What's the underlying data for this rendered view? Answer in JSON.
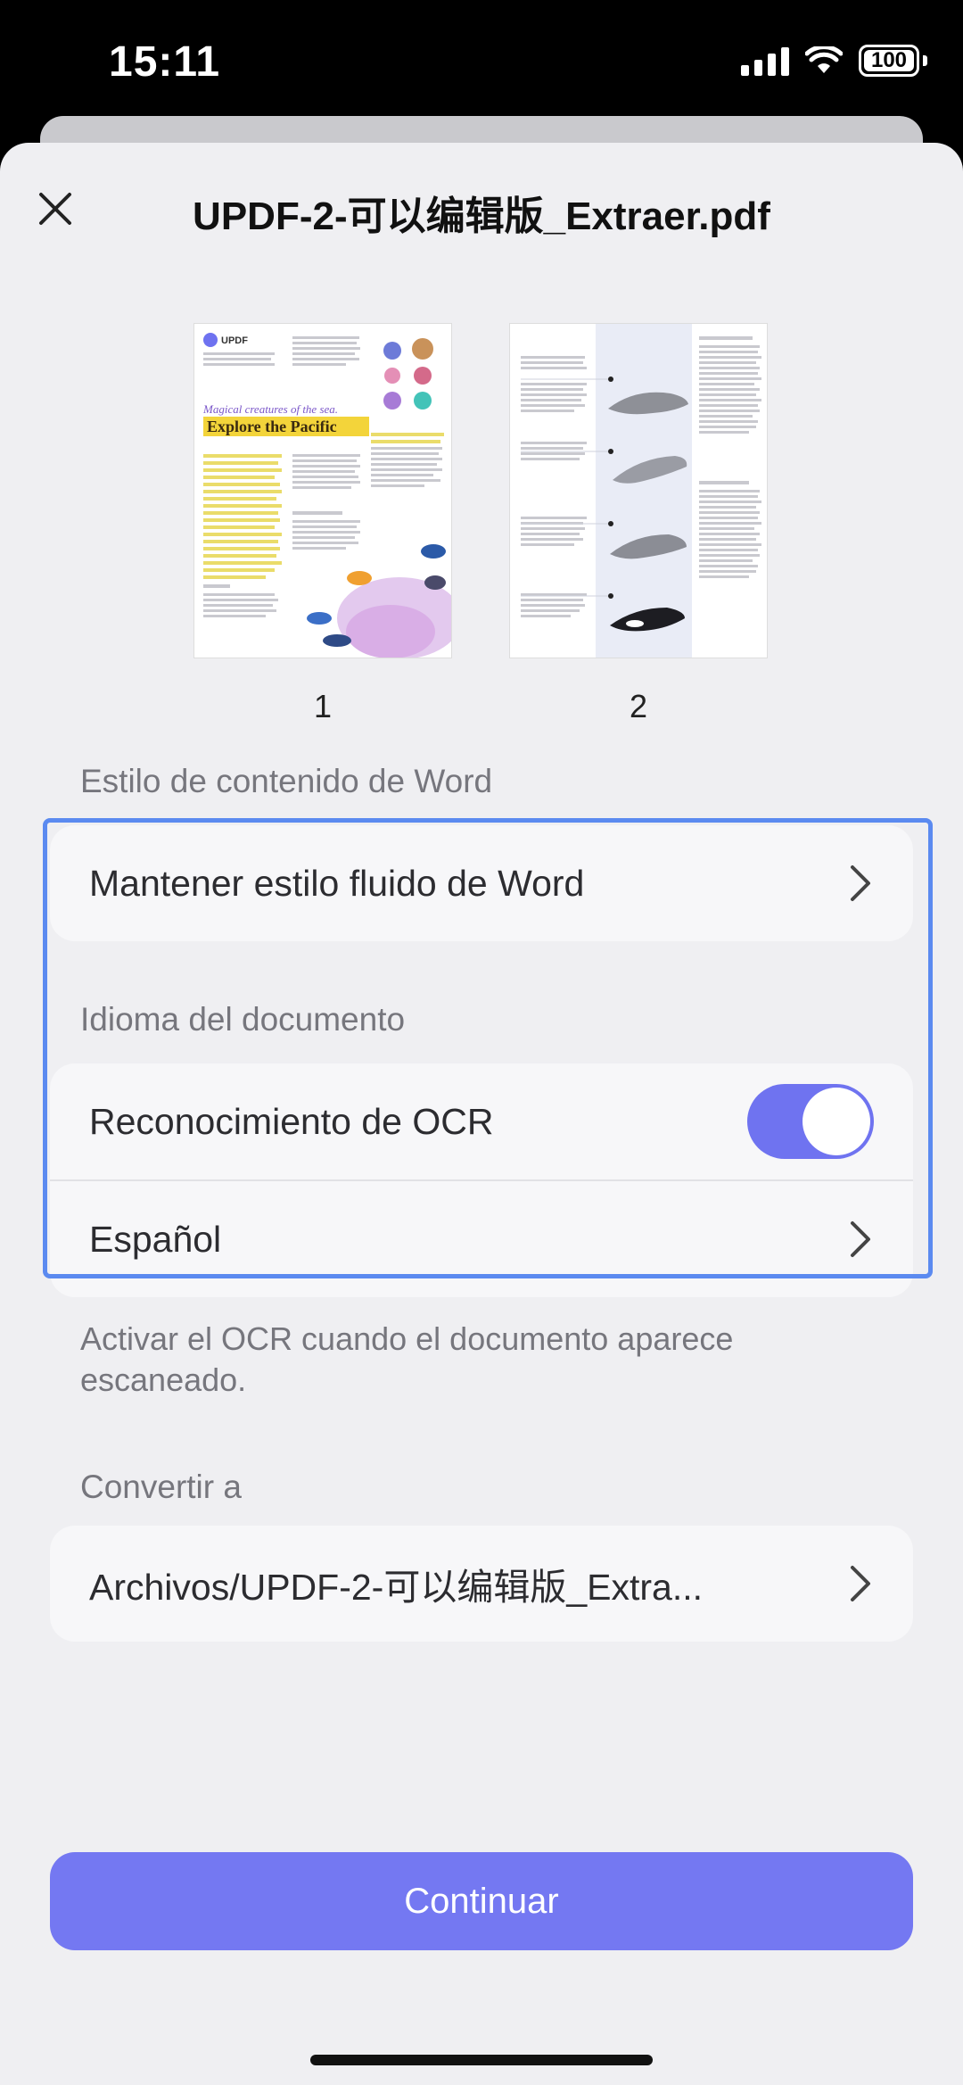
{
  "status": {
    "time": "15:11",
    "battery": "100"
  },
  "header": {
    "title": "UPDF-2-可以编辑版_Extraer.pdf"
  },
  "pages": [
    {
      "number": "1",
      "brand": "UPDF",
      "headline_small": "Magical creatures of the sea.",
      "headline": "Explore the Pacific"
    },
    {
      "number": "2"
    }
  ],
  "word_style": {
    "label": "Estilo de contenido de Word",
    "value": "Mantener estilo fluido de Word"
  },
  "language": {
    "label": "Idioma del documento",
    "ocr_label": "Reconocimiento de OCR",
    "ocr_enabled": true,
    "language_value": "Español",
    "hint": "Activar el OCR cuando el documento aparece escaneado."
  },
  "convert": {
    "label": "Convertir a",
    "value": "Archivos/UPDF-2-可以编辑版_Extra..."
  },
  "continue_button": "Continuar",
  "colors": {
    "accent": "#7478f2",
    "highlight": "#5b8af0"
  }
}
